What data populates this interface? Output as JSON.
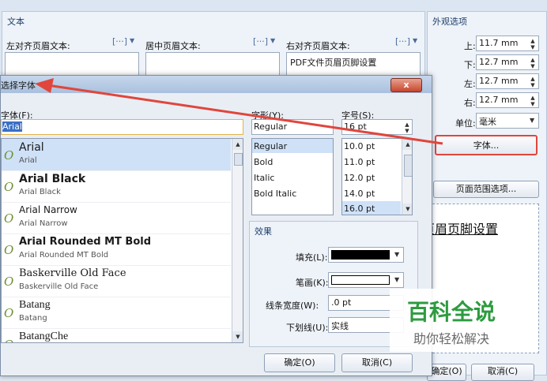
{
  "header": {
    "group_text": "文本",
    "left_label": "左对齐页眉文本:",
    "center_label": "居中页眉文本:",
    "right_label": "右对齐页眉文本:",
    "right_value": "PDF文件页眉页脚设置",
    "macro_btn": "[···]",
    "macro_caret": "▼"
  },
  "appearance": {
    "title": "外观选项",
    "top_label": "上:",
    "top_value": "11.7 mm",
    "bottom_label": "下:",
    "bottom_value": "12.7 mm",
    "left_label": "左:",
    "left_value": "12.7 mm",
    "right_label": "右:",
    "right_value": "12.7 mm",
    "unit_label": "单位:",
    "unit_value": "毫米",
    "font_button": "字体...",
    "page_range_button": "页面范围选项...",
    "preview_text": "页眉页脚设置"
  },
  "font_dialog": {
    "title": "选择字体",
    "close": "x",
    "font_label": "字体(F):",
    "font_value": "Arial",
    "style_label": "字形(Y):",
    "style_value": "Regular",
    "size_label": "字号(S):",
    "size_value": "16 pt",
    "fonts": [
      {
        "name": "Arial",
        "sub": "Arial"
      },
      {
        "name": "Arial Black",
        "sub": "Arial Black"
      },
      {
        "name": "Arial Narrow",
        "sub": "Arial Narrow"
      },
      {
        "name": "Arial Rounded MT Bold",
        "sub": "Arial Rounded MT Bold"
      },
      {
        "name": "Baskerville Old Face",
        "sub": "Baskerville Old Face"
      },
      {
        "name": "Batang",
        "sub": "Batang"
      },
      {
        "name": "BatangChe",
        "sub": ""
      }
    ],
    "styles": [
      "Regular",
      "Bold",
      "Italic",
      "Bold Italic"
    ],
    "sizes": [
      "10.0 pt",
      "11.0 pt",
      "12.0 pt",
      "14.0 pt",
      "16.0 pt"
    ],
    "effects_title": "效果",
    "fill_label": "填充(L):",
    "stroke_label": "笔画(K):",
    "line_width_label": "线条宽度(W):",
    "line_width_value": ".0 pt",
    "underline_label": "下划线(U):",
    "underline_value": "实线",
    "ok_button": "确定(O)",
    "cancel_button": "取消(C)"
  },
  "background_buttons": {
    "ok": "确定(O)",
    "cancel": "取消(C)"
  },
  "watermark": {
    "main": "百科全说",
    "sub": "助你轻松解决"
  },
  "colors": {
    "annotation_arrow": "#e0463c",
    "accent": "#2f6fb5",
    "watermark_green": "#2d9b3f"
  }
}
